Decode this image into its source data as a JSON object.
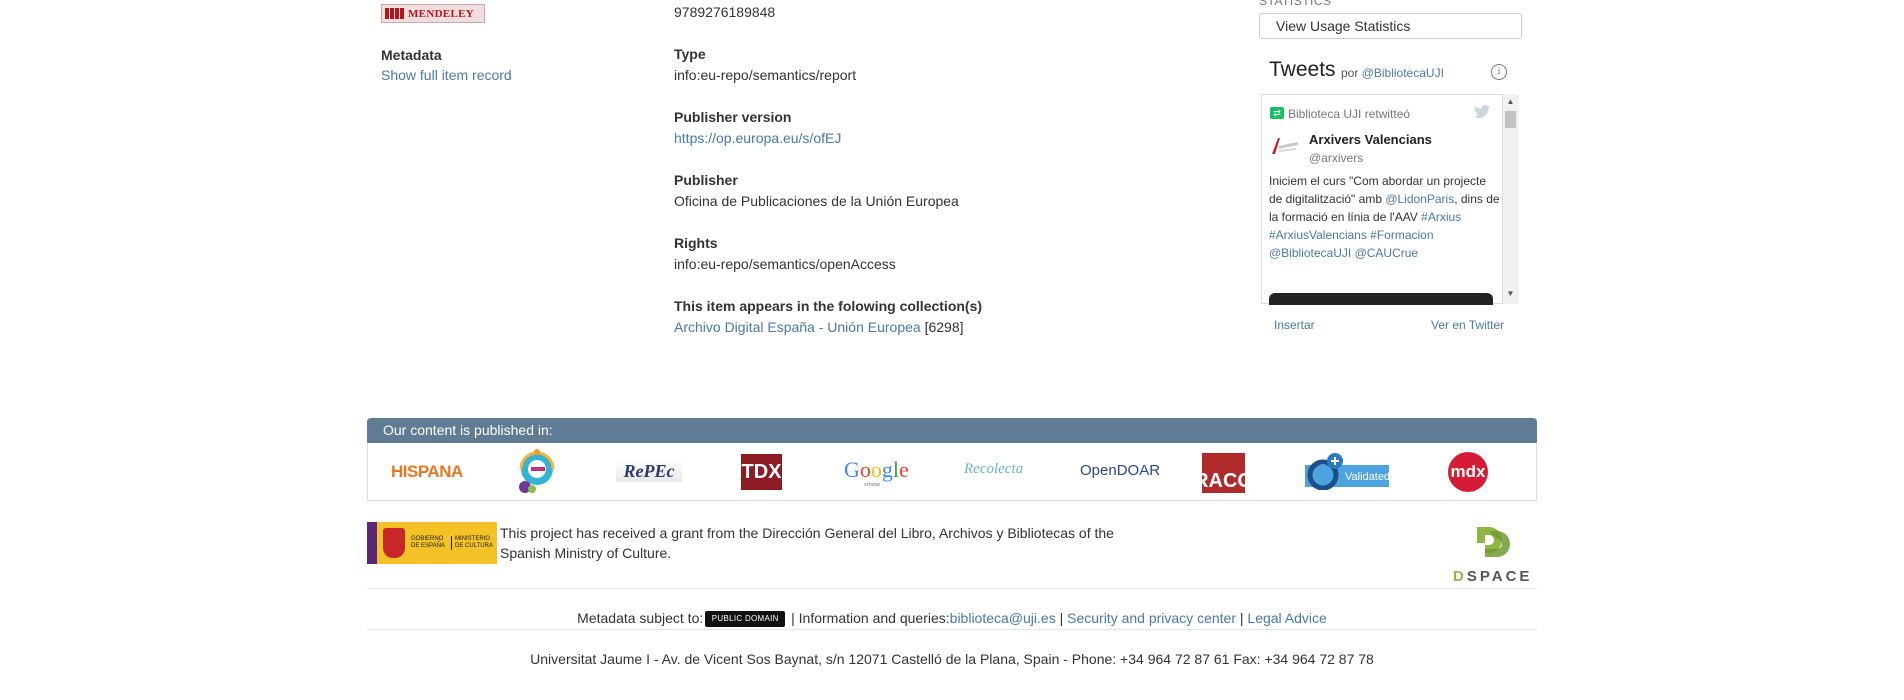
{
  "left": {
    "mendeley_logo_text": "MENDELEY",
    "metadata_label": "Metadata",
    "show_full_record": "Show full item record"
  },
  "item": {
    "isbn_value": "9789276189848",
    "type_label": "Type",
    "type_value": "info:eu-repo/semantics/report",
    "publisher_version_label": "Publisher version",
    "publisher_version_value": "https://op.europa.eu/s/ofEJ",
    "publisher_label": "Publisher",
    "publisher_value": "Oficina de Publicaciones de la Unión Europea",
    "rights_label": "Rights",
    "rights_value": "info:eu-repo/semantics/openAccess",
    "collections_label": "This item appears in the folowing collection(s)",
    "collection_link": "Archivo Digital España - Unión Europea",
    "collection_count": "[6298]"
  },
  "sidebar": {
    "statistics_heading": "STATISTICS",
    "usage_button": "View Usage Statistics",
    "tweets_title": "Tweets",
    "tweets_por": "por",
    "tweets_handle": "@BibliotecaUJI",
    "retweet_text": "Biblioteca UJI retwitteó",
    "account_name": "Arxivers Valencians",
    "account_handle": "@arxivers",
    "tweet_parts": [
      "Iniciem el curs \"Com abordar un projecte de digitalització\" amb ",
      "@LidonParis",
      ", dins de la formació en línia de l'AAV ",
      "#Arxius",
      " ",
      "#ArxiusValencians",
      " ",
      "#Formacion",
      " ",
      "@BibliotecaUJI",
      " ",
      "@CAUCrue"
    ],
    "insertar": "Insertar",
    "ver_en_twitter": "Ver en Twitter",
    "icons": [
      "info-icon",
      "retweet-icon",
      "twitter-bird-icon"
    ]
  },
  "published_in": {
    "heading": "Our content is published in:",
    "logos": {
      "hispana": "HISPANA",
      "repec": "RePEc",
      "tdx": "TDX",
      "google": "Google",
      "google_sub": "scholar",
      "recolecta": "Recolecta",
      "opendoar": "OpenDOAR",
      "raco": "RACO",
      "validated": "Validated",
      "mdx": "mdx"
    }
  },
  "grant": {
    "gobierno": "GOBIERNO DE ESPAÑA",
    "ministerio": "MINISTERIO DE CULTURA",
    "text": "This project has received a grant from the Dirección General del Libro, Archivos y Bibliotecas of the Spanish Ministry of Culture.",
    "dspace": "SPACE",
    "dspace_d": "D"
  },
  "footer": {
    "metadata_subject": "Metadata subject to:",
    "publicdomain_badge": "PUBLIC DOMAIN",
    "info_queries": " | Information and queries:",
    "email": "biblioteca@uji.es",
    "sep1": " | ",
    "security": "Security and privacy center",
    "sep2": " | ",
    "legal": "Legal Advice",
    "address": "Universitat Jaume I - Av. de Vicent Sos Baynat, s/n 12071 Castelló de la Plana, Spain - Phone: +34 964 72 87 61 Fax: +34 964 72 87 78"
  },
  "colors": {
    "link": "#4a7aa6",
    "panel_header": "#607b94",
    "dspace_green": "#8fb447"
  }
}
